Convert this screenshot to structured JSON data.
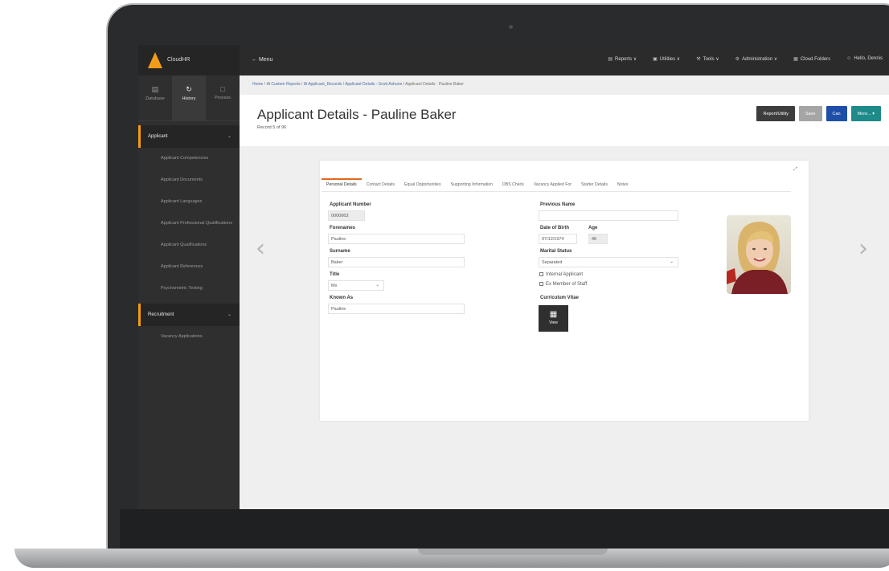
{
  "topbar": {
    "brand": "CloudHR",
    "menu": "← Menu",
    "nav": [
      {
        "icon": "▤",
        "label": "Reports ∨"
      },
      {
        "icon": "▣",
        "label": "Utilities ∨"
      },
      {
        "icon": "⚒",
        "label": "Tools ∨"
      },
      {
        "icon": "⚙",
        "label": "Administration ∨"
      },
      {
        "icon": "▦",
        "label": "Cloud Folders"
      },
      {
        "icon": "☺",
        "label": "Hello, Dennis"
      }
    ]
  },
  "sidebar": {
    "tabs": [
      {
        "icon": "▤",
        "label": "Database"
      },
      {
        "icon": "↻",
        "label": "History"
      },
      {
        "icon": "□",
        "label": "Process"
      }
    ],
    "groups": [
      {
        "label": "Applicant",
        "items": [
          "Applicant Competencies",
          "Applicant Documents",
          "Applicant Languages",
          "Applicant Professional Qualifications",
          "Applicant Qualifications",
          "Applicant References",
          "Psychometric Testing"
        ]
      },
      {
        "label": "Recruitment",
        "items": [
          "Vacancy Applications"
        ]
      }
    ]
  },
  "breadcrumb": {
    "parts": [
      "Home",
      "/",
      "IA Custom Reports",
      "/",
      "IA Applicant_Records",
      "/",
      "Applicant Details - Scott Ashune",
      "/"
    ],
    "current": "Applicant Details - Pauline Baker"
  },
  "header": {
    "title": "Applicant Details - Pauline Baker",
    "record": "Record 5 of 96",
    "buttons": {
      "report": "Report/Utility",
      "save": "Save",
      "cancel": "Can",
      "more": "More... ▾"
    }
  },
  "card": {
    "expand": "⤢",
    "tabs": [
      "Personal Details",
      "Contact Details",
      "Equal Opportunities",
      "Supporting Information",
      "DBS Check",
      "Vacancy Applied For",
      "Starter Details",
      "Notes"
    ],
    "left": {
      "applicant_number_label": "Applicant Number",
      "applicant_number": "0000063",
      "forenames_label": "Forenames",
      "forenames": "Pauline",
      "surname_label": "Surname",
      "surname": "Baker",
      "title_label": "Title",
      "title": "Ms",
      "known_as_label": "Known As",
      "known_as": "Pauline"
    },
    "right": {
      "previous_name_label": "Previous Name",
      "previous_name": "",
      "dob_label": "Date of Birth",
      "dob": "07/12/1974",
      "age_label": "Age",
      "age": "46",
      "marital_label": "Marital Status",
      "marital": "Separated",
      "internal": "Internal Applicant",
      "ex_member": "Ex Member of Staff",
      "cv_label": "Curriculum Vitae",
      "cv_button": "View"
    }
  },
  "nav_arrows": {
    "prev": "‹",
    "next": "›"
  }
}
